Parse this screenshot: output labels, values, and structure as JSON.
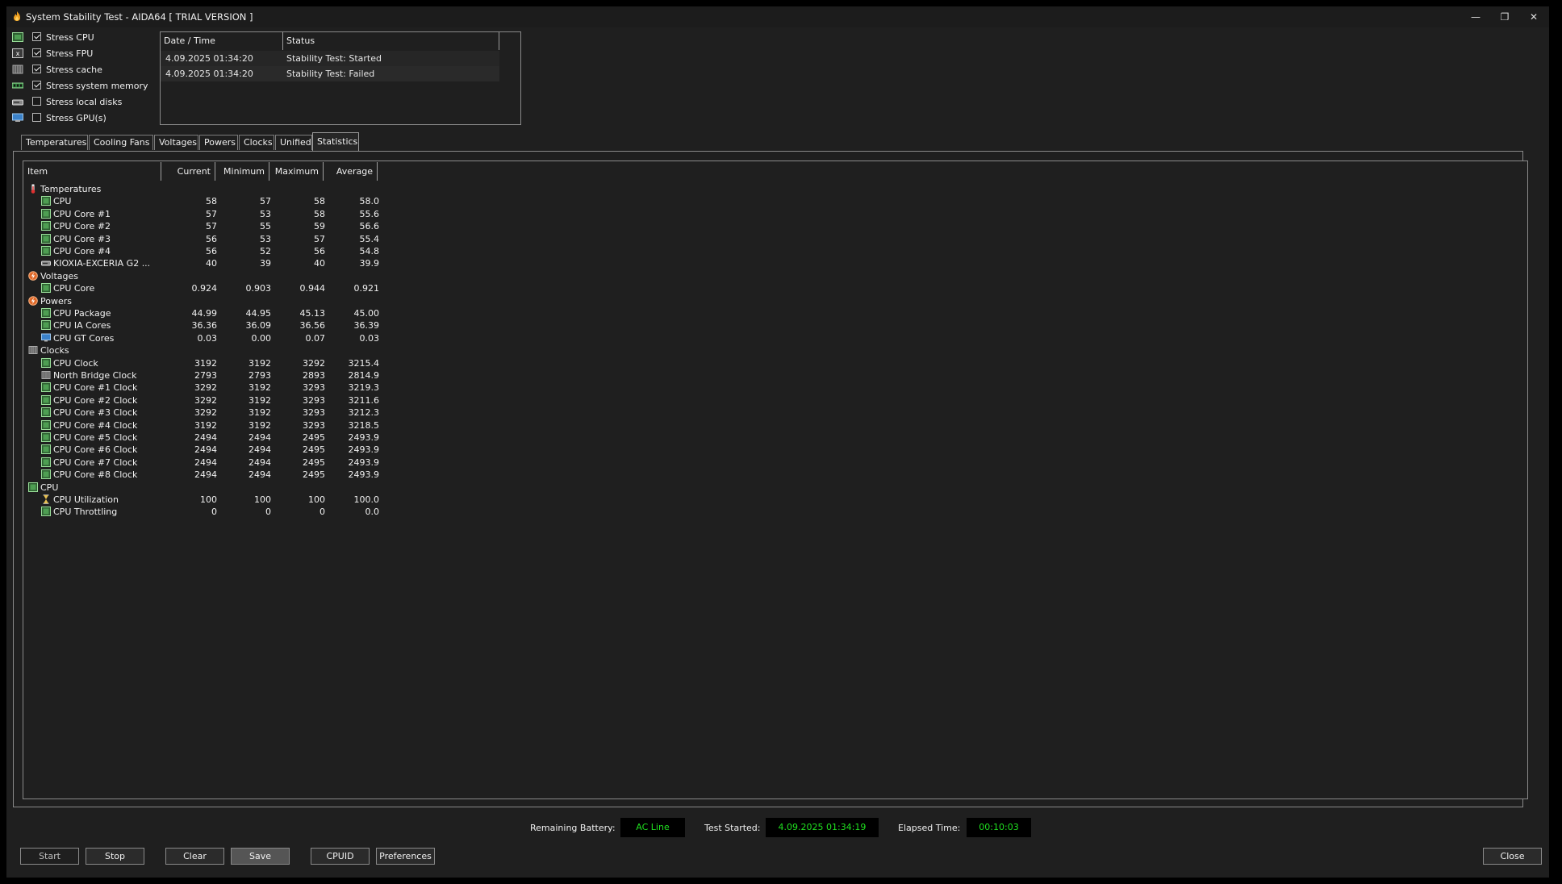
{
  "window": {
    "title": "System Stability Test - AIDA64  [ TRIAL VERSION ]",
    "controls": {
      "minimize": "—",
      "maximize": "❐",
      "close": "✕"
    }
  },
  "stress": [
    {
      "label": "Stress CPU",
      "checked": true,
      "icon": "cpu-chip-icon"
    },
    {
      "label": "Stress FPU",
      "checked": true,
      "icon": "fpu-icon"
    },
    {
      "label": "Stress cache",
      "checked": true,
      "icon": "cache-icon"
    },
    {
      "label": "Stress system memory",
      "checked": true,
      "icon": "memory-icon"
    },
    {
      "label": "Stress local disks",
      "checked": false,
      "icon": "disk-icon"
    },
    {
      "label": "Stress GPU(s)",
      "checked": false,
      "icon": "gpu-icon"
    }
  ],
  "log": {
    "columns": [
      "Date / Time",
      "Status"
    ],
    "rows": [
      {
        "time": "4.09.2025 01:34:20",
        "status": "Stability Test: Started"
      },
      {
        "time": "4.09.2025 01:34:20",
        "status": "Stability Test: Failed"
      }
    ]
  },
  "tabs": [
    "Temperatures",
    "Cooling Fans",
    "Voltages",
    "Powers",
    "Clocks",
    "Unified",
    "Statistics"
  ],
  "active_tab": "Statistics",
  "stats": {
    "columns": {
      "item": "Item",
      "current": "Current",
      "minimum": "Minimum",
      "maximum": "Maximum",
      "average": "Average"
    },
    "rows": [
      {
        "type": "group",
        "label": "Temperatures",
        "icon": "thermometer-icon"
      },
      {
        "type": "item",
        "label": "CPU",
        "icon": "cpu-chip-icon",
        "cur": "58",
        "min": "57",
        "max": "58",
        "avg": "58.0"
      },
      {
        "type": "item",
        "label": "CPU Core #1",
        "icon": "cpu-chip-icon",
        "cur": "57",
        "min": "53",
        "max": "58",
        "avg": "55.6"
      },
      {
        "type": "item",
        "label": "CPU Core #2",
        "icon": "cpu-chip-icon",
        "cur": "57",
        "min": "55",
        "max": "59",
        "avg": "56.6"
      },
      {
        "type": "item",
        "label": "CPU Core #3",
        "icon": "cpu-chip-icon",
        "cur": "56",
        "min": "53",
        "max": "57",
        "avg": "55.4"
      },
      {
        "type": "item",
        "label": "CPU Core #4",
        "icon": "cpu-chip-icon",
        "cur": "56",
        "min": "52",
        "max": "56",
        "avg": "54.8"
      },
      {
        "type": "item",
        "label": "KIOXIA-EXCERIA G2 ...",
        "icon": "disk-icon",
        "cur": "40",
        "min": "39",
        "max": "40",
        "avg": "39.9"
      },
      {
        "type": "group",
        "label": "Voltages",
        "icon": "voltage-icon"
      },
      {
        "type": "item",
        "label": "CPU Core",
        "icon": "cpu-chip-icon",
        "cur": "0.924",
        "min": "0.903",
        "max": "0.944",
        "avg": "0.921"
      },
      {
        "type": "group",
        "label": "Powers",
        "icon": "power-icon"
      },
      {
        "type": "item",
        "label": "CPU Package",
        "icon": "cpu-chip-icon",
        "cur": "44.99",
        "min": "44.95",
        "max": "45.13",
        "avg": "45.00"
      },
      {
        "type": "item",
        "label": "CPU IA Cores",
        "icon": "cpu-chip-icon",
        "cur": "36.36",
        "min": "36.09",
        "max": "36.56",
        "avg": "36.39"
      },
      {
        "type": "item",
        "label": "CPU GT Cores",
        "icon": "monitor-icon",
        "cur": "0.03",
        "min": "0.00",
        "max": "0.07",
        "avg": "0.03"
      },
      {
        "type": "group",
        "label": "Clocks",
        "icon": "clock-chip-icon"
      },
      {
        "type": "item",
        "label": "CPU Clock",
        "icon": "cpu-chip-icon",
        "cur": "3192",
        "min": "3192",
        "max": "3292",
        "avg": "3215.4"
      },
      {
        "type": "item",
        "label": "North Bridge Clock",
        "icon": "northbridge-icon",
        "cur": "2793",
        "min": "2793",
        "max": "2893",
        "avg": "2814.9"
      },
      {
        "type": "item",
        "label": "CPU Core #1 Clock",
        "icon": "cpu-chip-icon",
        "cur": "3292",
        "min": "3192",
        "max": "3293",
        "avg": "3219.3"
      },
      {
        "type": "item",
        "label": "CPU Core #2 Clock",
        "icon": "cpu-chip-icon",
        "cur": "3292",
        "min": "3192",
        "max": "3293",
        "avg": "3211.6"
      },
      {
        "type": "item",
        "label": "CPU Core #3 Clock",
        "icon": "cpu-chip-icon",
        "cur": "3292",
        "min": "3192",
        "max": "3293",
        "avg": "3212.3"
      },
      {
        "type": "item",
        "label": "CPU Core #4 Clock",
        "icon": "cpu-chip-icon",
        "cur": "3192",
        "min": "3192",
        "max": "3293",
        "avg": "3218.5"
      },
      {
        "type": "item",
        "label": "CPU Core #5 Clock",
        "icon": "cpu-chip-icon",
        "cur": "2494",
        "min": "2494",
        "max": "2495",
        "avg": "2493.9"
      },
      {
        "type": "item",
        "label": "CPU Core #6 Clock",
        "icon": "cpu-chip-icon",
        "cur": "2494",
        "min": "2494",
        "max": "2495",
        "avg": "2493.9"
      },
      {
        "type": "item",
        "label": "CPU Core #7 Clock",
        "icon": "cpu-chip-icon",
        "cur": "2494",
        "min": "2494",
        "max": "2495",
        "avg": "2493.9"
      },
      {
        "type": "item",
        "label": "CPU Core #8 Clock",
        "icon": "cpu-chip-icon",
        "cur": "2494",
        "min": "2494",
        "max": "2495",
        "avg": "2493.9"
      },
      {
        "type": "group",
        "label": "CPU",
        "icon": "cpu-chip-icon"
      },
      {
        "type": "item",
        "label": "CPU Utilization",
        "icon": "hourglass-icon",
        "cur": "100",
        "min": "100",
        "max": "100",
        "avg": "100.0"
      },
      {
        "type": "item",
        "label": "CPU Throttling",
        "icon": "cpu-chip-icon",
        "cur": "0",
        "min": "0",
        "max": "0",
        "avg": "0.0"
      }
    ]
  },
  "status_bar": {
    "battery_label": "Remaining Battery:",
    "battery_value": "AC Line",
    "started_label": "Test Started:",
    "started_value": "4.09.2025 01:34:19",
    "elapsed_label": "Elapsed Time:",
    "elapsed_value": "00:10:03"
  },
  "buttons": {
    "start": "Start",
    "stop": "Stop",
    "clear": "Clear",
    "save": "Save",
    "cpuid": "CPUID",
    "preferences": "Preferences",
    "close": "Close"
  },
  "colors": {
    "background": "#1f1f1f",
    "status_value": "#1fe01f",
    "chip": "#2e5f31"
  }
}
